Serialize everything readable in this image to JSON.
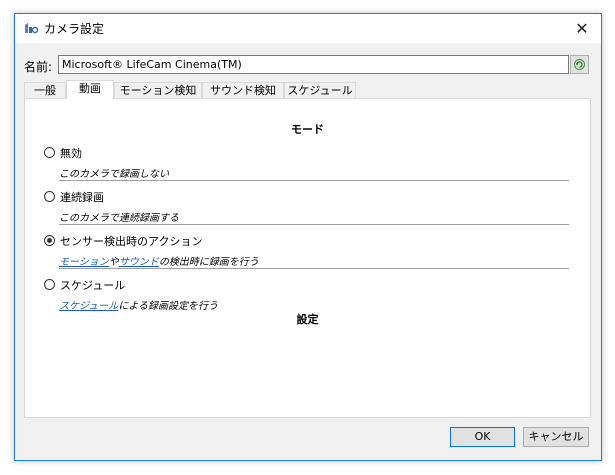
{
  "window": {
    "title": "カメラ設定",
    "close_glyph": "✕"
  },
  "name": {
    "label": "名前:",
    "value": "Microsoft® LifeCam Cinema(TM)"
  },
  "tabs": [
    {
      "label": "一般"
    },
    {
      "label": "動画"
    },
    {
      "label": "モーション検知"
    },
    {
      "label": "サウンド検知"
    },
    {
      "label": "スケジュール"
    }
  ],
  "active_tab": "動画",
  "mode": {
    "heading": "モード",
    "options": [
      {
        "label": "無効",
        "desc": "このカメラで録画しない",
        "selected": false
      },
      {
        "label": "連続録画",
        "desc": "このカメラで連続録画する",
        "selected": false
      },
      {
        "label": "センサー検出時のアクション",
        "desc_link1": "モーション",
        "desc_mid": "や",
        "desc_link2": "サウンド",
        "desc_end": "の検出時に録画を行う",
        "selected": true
      },
      {
        "label": "スケジュール",
        "desc_link": "スケジュール",
        "desc_end": "による録画設定を行う",
        "selected": false
      }
    ]
  },
  "settings_heading": "設定",
  "buttons": {
    "ok": "OK",
    "cancel": "キャンセル"
  },
  "colors": {
    "accent": "#0078d7",
    "link": "#1a5fb4",
    "border": "#1c82d8"
  }
}
